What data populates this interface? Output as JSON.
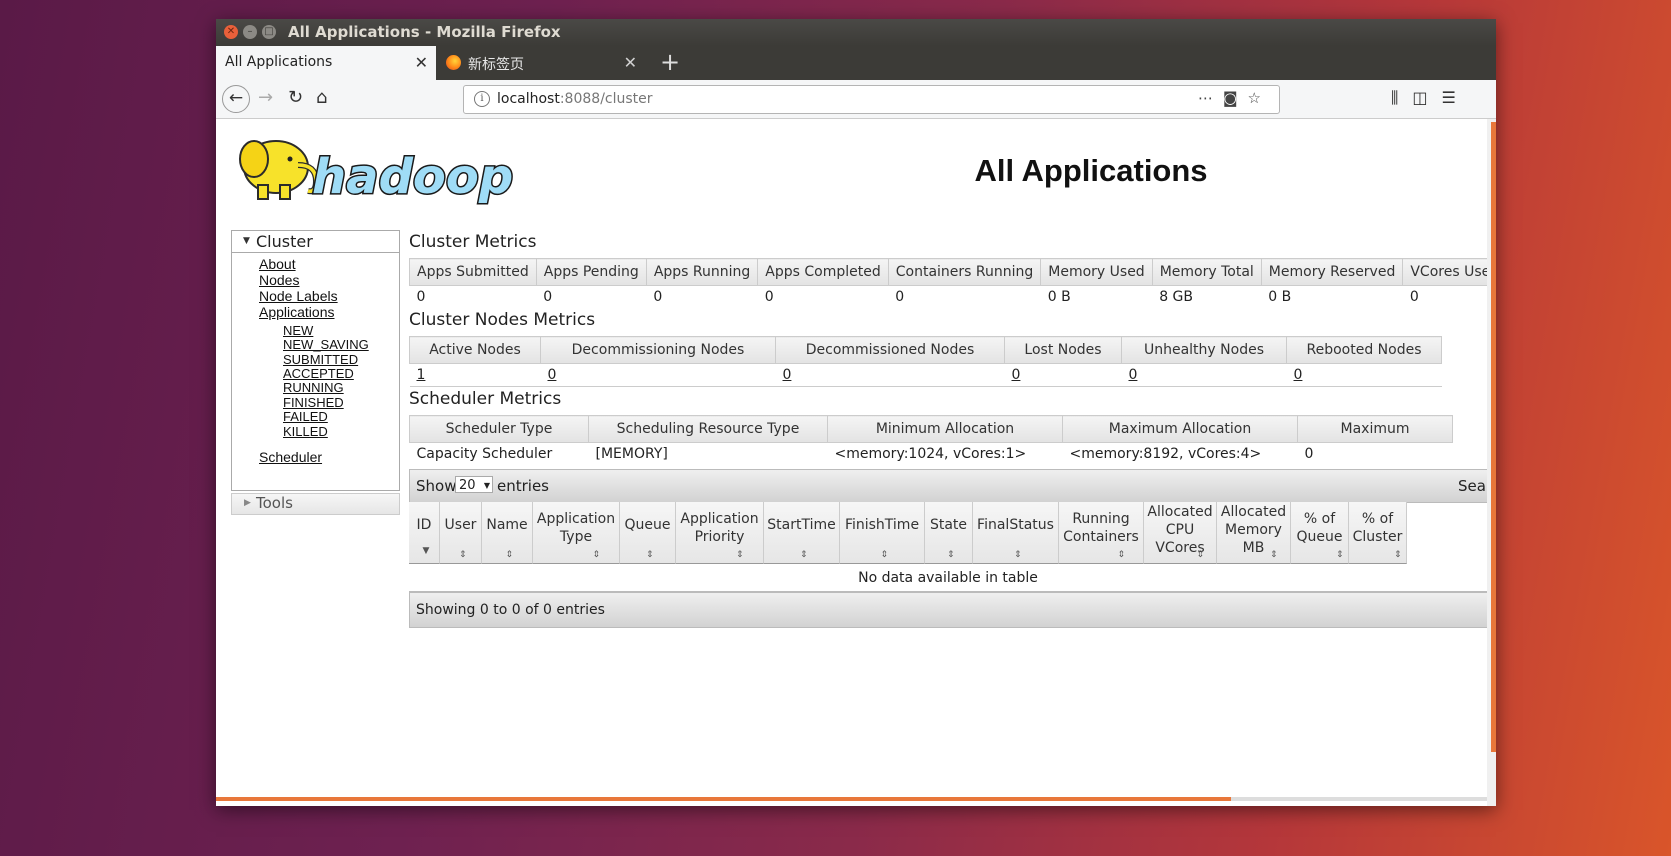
{
  "window": {
    "title": "All Applications - Mozilla Firefox"
  },
  "tabs": [
    {
      "label": "All Applications"
    },
    {
      "label": "新标签页"
    }
  ],
  "urlbar": {
    "host": "localhost",
    "rest": ":8088/cluster"
  },
  "page": {
    "title": "All Applications",
    "logo_text": "hadoop"
  },
  "sidebar": {
    "cluster_label": "Cluster",
    "links": [
      "About",
      "Nodes",
      "Node Labels",
      "Applications"
    ],
    "app_states": [
      "NEW",
      "NEW_SAVING",
      "SUBMITTED",
      "ACCEPTED",
      "RUNNING",
      "FINISHED",
      "FAILED",
      "KILLED"
    ],
    "scheduler": "Scheduler",
    "tools_label": "Tools"
  },
  "cluster_metrics": {
    "title": "Cluster Metrics",
    "headers": [
      "Apps Submitted",
      "Apps Pending",
      "Apps Running",
      "Apps Completed",
      "Containers Running",
      "Memory Used",
      "Memory Total",
      "Memory Reserved",
      "VCores Used"
    ],
    "values": [
      "0",
      "0",
      "0",
      "0",
      "0",
      "0 B",
      "8 GB",
      "0 B",
      "0"
    ]
  },
  "nodes_metrics": {
    "title": "Cluster Nodes Metrics",
    "headers": [
      "Active Nodes",
      "Decommissioning Nodes",
      "Decommissioned Nodes",
      "Lost Nodes",
      "Unhealthy Nodes",
      "Rebooted Nodes"
    ],
    "values": [
      "1",
      "0",
      "0",
      "0",
      "0",
      "0"
    ]
  },
  "scheduler_metrics": {
    "title": "Scheduler Metrics",
    "headers": [
      "Scheduler Type",
      "Scheduling Resource Type",
      "Minimum Allocation",
      "Maximum Allocation",
      "Maximum"
    ],
    "values": [
      "Capacity Scheduler",
      "[MEMORY]",
      "<memory:1024, vCores:1>",
      "<memory:8192, vCores:4>",
      "0"
    ]
  },
  "datatable": {
    "show_label": "Show",
    "page_size": "20",
    "entries_label": "entries",
    "search_label": "Search:",
    "columns": [
      [
        "ID"
      ],
      [
        "User"
      ],
      [
        "Name"
      ],
      [
        "Application",
        "Type"
      ],
      [
        "Queue"
      ],
      [
        "Application",
        "Priority"
      ],
      [
        "StartTime"
      ],
      [
        "FinishTime"
      ],
      [
        "State"
      ],
      [
        "FinalStatus"
      ],
      [
        "Running",
        "Containers"
      ],
      [
        "Allocated",
        "CPU",
        "VCores"
      ],
      [
        "Allocated",
        "Memory",
        "MB"
      ],
      [
        "% of",
        "Queue"
      ],
      [
        "% of",
        "Cluster"
      ]
    ],
    "empty_message": "No data available in table",
    "footer": "Showing 0 to 0 of 0 entries"
  }
}
